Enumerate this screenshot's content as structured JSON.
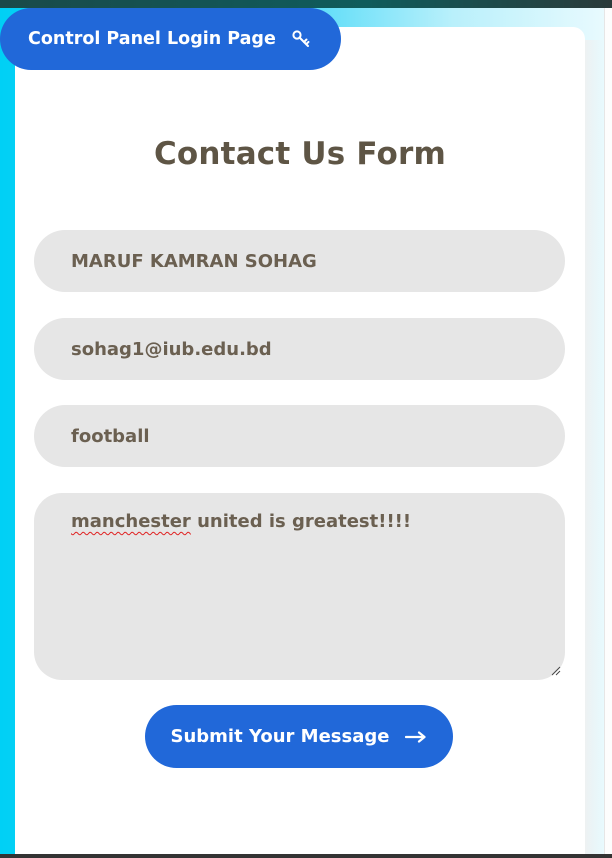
{
  "header": {
    "login_button_label": "Control Panel Login Page",
    "login_icon": "key-icon"
  },
  "form": {
    "title": "Contact Us Form",
    "name_value": "MARUF KAMRAN SOHAG",
    "email_value": "sohag1@iub.edu.bd",
    "subject_value": "football",
    "message_misspelled_word": "manchester",
    "message_rest": " united is greatest!!!!",
    "submit_label": "Submit Your Message",
    "submit_icon": "arrow-right-icon"
  },
  "colors": {
    "accent": "#2168d9",
    "field_bg": "#e6e6e6",
    "text": "#6b6051",
    "title": "#5e5545",
    "side_bar": "#00d0f5"
  }
}
